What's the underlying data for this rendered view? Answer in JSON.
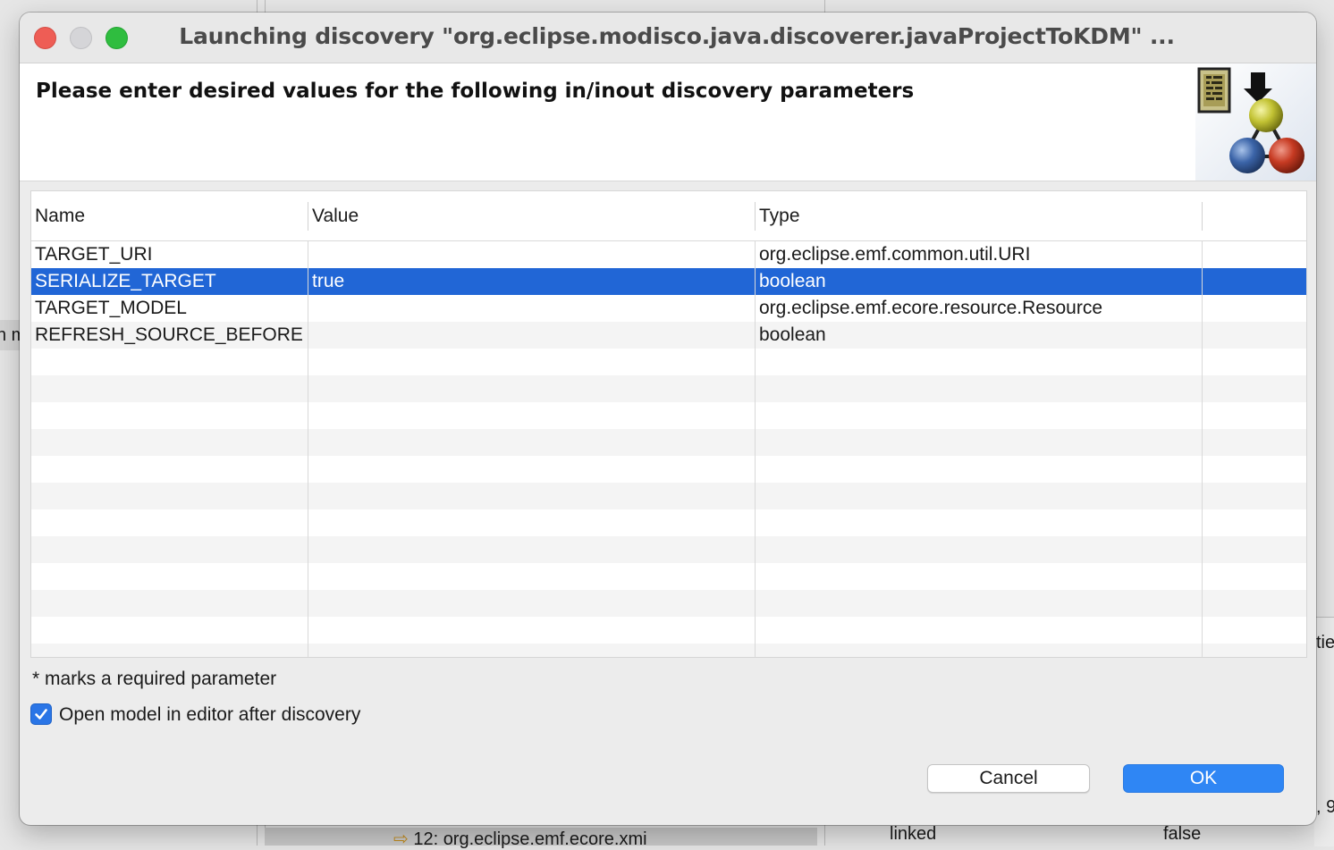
{
  "window": {
    "title": "Launching discovery \"org.eclipse.modisco.java.discoverer.javaProjectToKDM\" ..."
  },
  "header": {
    "message": "Please enter desired values for the following in/inout discovery parameters",
    "icon": "discovery-wizard-icon"
  },
  "table": {
    "columns": [
      "Name",
      "Value",
      "Type"
    ],
    "rows": [
      {
        "name": "TARGET_URI",
        "value": "",
        "type": "org.eclipse.emf.common.util.URI"
      },
      {
        "name": "SERIALIZE_TARGET",
        "value": "true",
        "type": "boolean"
      },
      {
        "name": "TARGET_MODEL",
        "value": "",
        "type": "org.eclipse.emf.ecore.resource.Resource"
      },
      {
        "name": "REFRESH_SOURCE_BEFORE",
        "value": "",
        "type": "boolean"
      }
    ],
    "selected_row": 1
  },
  "note": "* marks a required parameter",
  "open_in_editor": {
    "label": "Open model in editor after discovery",
    "checked": true
  },
  "buttons": {
    "cancel": "Cancel",
    "ok": "OK"
  },
  "background": {
    "left_fragment": "n m",
    "right_fragment_1": "tie",
    "right_fragment_2": ", 9",
    "bottom_item": "12: org.eclipse.emf.ecore.xmi",
    "bottom_linked": "linked",
    "bottom_false": "false"
  },
  "colors": {
    "selection": "#2166d6",
    "ok_button": "#2f86f4",
    "close": "#ee5d55",
    "zoom": "#2fbd3f"
  }
}
